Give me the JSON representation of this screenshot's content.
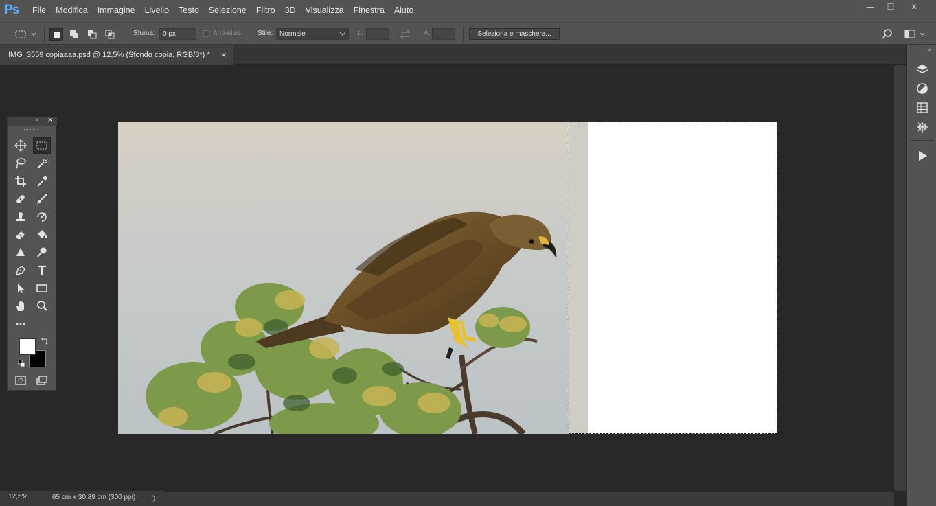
{
  "app": {
    "logo": "Ps"
  },
  "menu": [
    "File",
    "Modifica",
    "Immagine",
    "Livello",
    "Testo",
    "Selezione",
    "Filtro",
    "3D",
    "Visualizza",
    "Finestra",
    "Aiuto"
  ],
  "window_controls": {
    "minimize": "—",
    "maximize": "☐",
    "close": "✕"
  },
  "options": {
    "feather_label": "Sfuma:",
    "feather_value": "0 px",
    "antialias_label": "Anti-alias",
    "style_label": "Stile:",
    "style_value": "Normale",
    "width_label": "L:",
    "height_label": "A:",
    "select_mask_button": "Seleziona e maschera..."
  },
  "document_tab": {
    "title": "IMG_3559 copiaaaa.psd @ 12,5% (Sfondo copia, RGB/8*) *",
    "close": "×"
  },
  "status": {
    "zoom": "12,5%",
    "doc_info": "65 cm x 30,89 cm (300 ppi)",
    "arrow": "〉"
  },
  "colors": {
    "ui_bg": "#535353",
    "workspace": "#282828",
    "foreground": "#ffffff",
    "background": "#000000",
    "accent": "#5ab0ff"
  },
  "tools": [
    "move-tool",
    "rectangular-marquee-tool",
    "lasso-tool",
    "magic-wand-tool",
    "crop-tool",
    "eyedropper-tool",
    "healing-brush-tool",
    "brush-tool",
    "clone-stamp-tool",
    "history-brush-tool",
    "eraser-tool",
    "paint-bucket-tool",
    "blur-tool",
    "dodge-tool",
    "pen-tool",
    "type-tool",
    "path-selection-tool",
    "rectangle-tool",
    "hand-tool",
    "zoom-tool",
    "edit-toolbar"
  ]
}
